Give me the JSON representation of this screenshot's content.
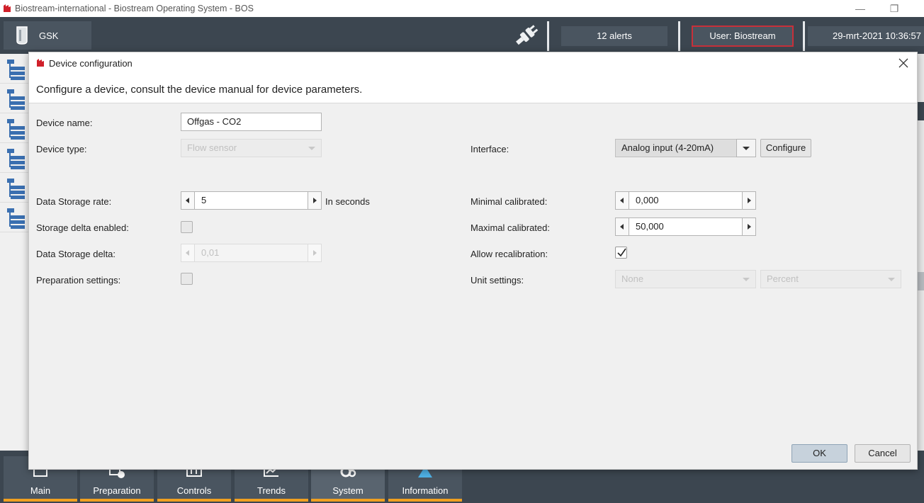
{
  "window": {
    "title": "Biostream-international - Biostream Operating System - BOS",
    "minimize": "—",
    "restore": "❐"
  },
  "topbar": {
    "plant": "GSK",
    "alerts": "12 alerts",
    "user": "User: Biostream",
    "datetime": "29-mrt-2021 10:36:57"
  },
  "bottom_nav": [
    {
      "label": "Main"
    },
    {
      "label": "Preparation"
    },
    {
      "label": "Controls"
    },
    {
      "label": "Trends"
    },
    {
      "label": "System"
    },
    {
      "label": "Information"
    }
  ],
  "dialog": {
    "title": "Device configuration",
    "subtitle": "Configure a device, consult the device manual for device parameters.",
    "left": {
      "device_name_label": "Device name:",
      "device_name_value": "Offgas - CO2",
      "device_type_label": "Device type:",
      "device_type_value": "Flow sensor",
      "storage_rate_label": "Data Storage rate:",
      "storage_rate_value": "5",
      "storage_rate_unit": "In seconds",
      "storage_delta_enabled_label": "Storage delta enabled:",
      "storage_delta_enabled": false,
      "storage_delta_label": "Data Storage delta:",
      "storage_delta_value": "0,01",
      "preparation_label": "Preparation settings:",
      "preparation_enabled": false
    },
    "right": {
      "interface_label": "Interface:",
      "interface_value": "Analog input (4-20mA)",
      "configure_button": "Configure",
      "min_cal_label": "Minimal calibrated:",
      "min_cal_value": "0,000",
      "max_cal_label": "Maximal calibrated:",
      "max_cal_value": "50,000",
      "allow_recal_label": "Allow recalibration:",
      "allow_recal": true,
      "unit_label": "Unit settings:",
      "unit_value_1": "None",
      "unit_value_2": "Percent"
    },
    "ok_button": "OK",
    "cancel_button": "Cancel"
  }
}
